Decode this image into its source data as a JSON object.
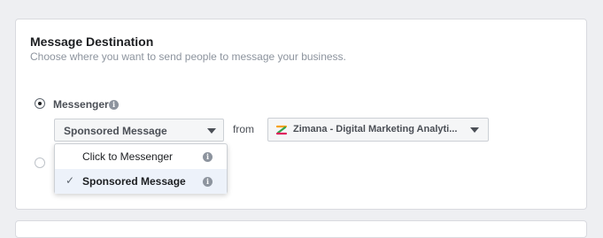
{
  "section": {
    "title": "Message Destination",
    "subtitle": "Choose where you want to send people to message your business."
  },
  "options": {
    "messenger": {
      "label": "Messenger",
      "checked": true
    },
    "second": {
      "label": "",
      "checked": false
    }
  },
  "message_type": {
    "selected": "Sponsored Message",
    "items": [
      {
        "label": "Click to Messenger",
        "selected": false
      },
      {
        "label": "Sponsored Message",
        "selected": true
      }
    ]
  },
  "from_label": "from",
  "page": {
    "name": "Zimana - Digital Marketing Analyti..."
  },
  "icons": {
    "info": "info-icon",
    "caret": "chevron-down-icon",
    "check": "check-icon",
    "page_logo": "page-logo-icon"
  },
  "colors": {
    "selected_item_bg": "#edf2fa",
    "background": "#eeeff2"
  }
}
